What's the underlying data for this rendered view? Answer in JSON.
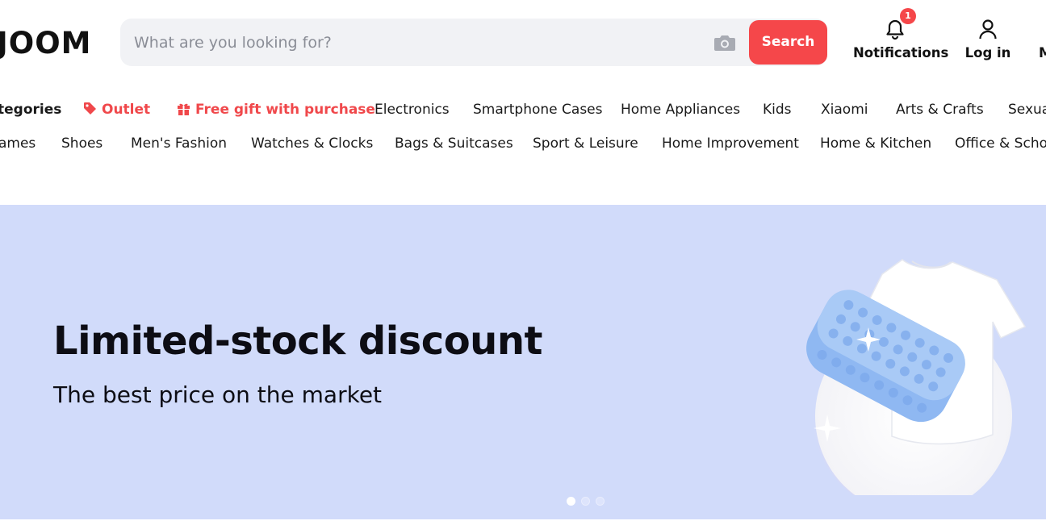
{
  "header": {
    "logo_text": "JOOM",
    "search": {
      "placeholder": "What are you looking for?",
      "value": "",
      "button_label": "Search"
    },
    "actions": {
      "notifications_label": "Notifications",
      "notifications_count": "1",
      "login_label": "Log in",
      "more_label": "M"
    }
  },
  "nav": {
    "row1": [
      {
        "label": "tegories",
        "type": "bold"
      },
      {
        "label": "Outlet",
        "type": "promo",
        "icon": "tag-icon"
      },
      {
        "label": "Free gift with purchase",
        "type": "promo",
        "icon": "gift-icon"
      },
      {
        "label": "Electronics"
      },
      {
        "label": "Smartphone Cases"
      },
      {
        "label": "Home Appliances"
      },
      {
        "label": "Kids"
      },
      {
        "label": "Xiaomi"
      },
      {
        "label": "Arts & Crafts"
      },
      {
        "label": "Sexua"
      }
    ],
    "row2": [
      {
        "label": "ames"
      },
      {
        "label": "Shoes"
      },
      {
        "label": "Men's Fashion"
      },
      {
        "label": "Watches & Clocks"
      },
      {
        "label": "Bags & Suitcases"
      },
      {
        "label": "Sport & Leisure"
      },
      {
        "label": "Home Improvement"
      },
      {
        "label": "Home & Kitchen"
      },
      {
        "label": "Office & Schoo"
      }
    ]
  },
  "banner": {
    "title": "Limited-stock discount",
    "subtitle": "The best price on the market",
    "slides_total": 3,
    "active_slide": 1
  },
  "colors": {
    "accent": "#f5474a",
    "banner_bg": "#d1dbfa",
    "promo_text": "#f0484b"
  }
}
